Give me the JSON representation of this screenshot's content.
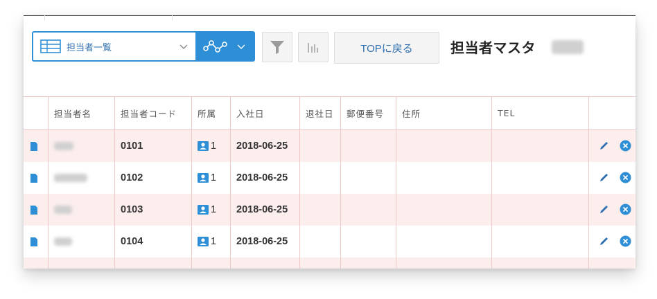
{
  "toolbar": {
    "view_label": "担当者一覧",
    "top_button_label": "TOPに戻る",
    "page_title": "担当者マスタ"
  },
  "table": {
    "headers": [
      "担当者名",
      "担当者コード",
      "所属",
      "入社日",
      "退社日",
      "郵便番号",
      "住所",
      "TEL"
    ],
    "rows": [
      {
        "code": "0101",
        "dept": "1",
        "hire_date": "2018-06-25"
      },
      {
        "code": "0102",
        "dept": "1",
        "hire_date": "2018-06-25"
      },
      {
        "code": "0103",
        "dept": "1",
        "hire_date": "2018-06-25"
      },
      {
        "code": "0104",
        "dept": "1",
        "hire_date": "2018-06-25"
      }
    ]
  },
  "icons": {
    "view_grid": "table-grid-icon",
    "chart": "line-chart-icon",
    "filter": "funnel-icon",
    "bar_chart": "bar-chart-icon",
    "record": "document-icon",
    "department": "person-badge-icon",
    "edit": "pencil-icon",
    "delete": "close-circle-icon"
  },
  "colors": {
    "accent": "#2f8fd6",
    "link_text": "#2f6fb0",
    "row_stripe": "#fdeeee",
    "grid_line": "#f0c8c8"
  }
}
